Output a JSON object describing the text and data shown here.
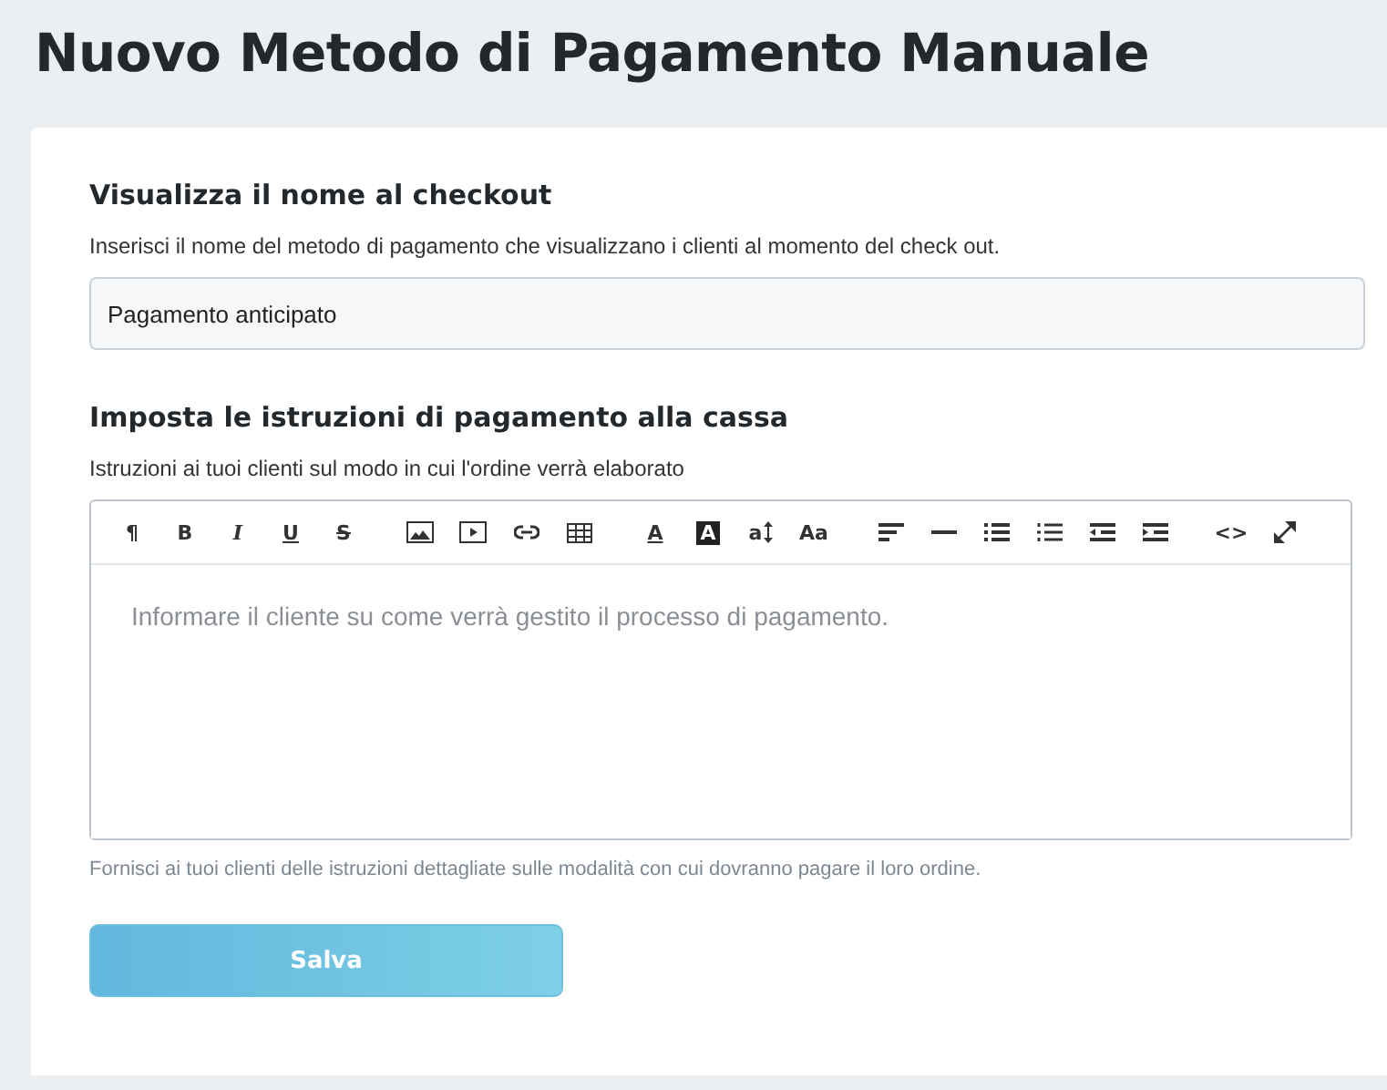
{
  "page_title": "Nuovo Metodo di Pagamento Manuale",
  "name_section": {
    "heading": "Visualizza il nome al checkout",
    "description": "Inserisci il nome del metodo di pagamento che visualizzano i clienti al momento del check out.",
    "value": "Pagamento anticipato"
  },
  "instructions_section": {
    "heading": "Imposta le istruzioni di pagamento alla cassa",
    "description": "Istruzioni ai tuoi clienti sul modo in cui l'ordine verrà elaborato",
    "placeholder": "Informare il cliente su come verrà gestito il processo di pagamento.",
    "hint": "Fornisci ai tuoi clienti delle istruzioni dettagliate sulle modalità con cui dovranno pagare il loro ordine."
  },
  "toolbar_groups": [
    [
      {
        "kind": "glyph",
        "label": "¶"
      },
      {
        "kind": "bold",
        "label": "B"
      },
      {
        "kind": "italic",
        "label": "I"
      },
      {
        "kind": "underline",
        "label": "U"
      },
      {
        "kind": "strike",
        "label": "S"
      }
    ],
    [
      {
        "kind": "image"
      },
      {
        "kind": "video"
      },
      {
        "kind": "link"
      },
      {
        "kind": "table"
      }
    ],
    [
      {
        "kind": "font-color",
        "label": "A"
      },
      {
        "kind": "bg-color",
        "label": "A"
      },
      {
        "kind": "font-size",
        "label": "a"
      },
      {
        "kind": "glyph",
        "label": "Aa"
      }
    ],
    [
      {
        "kind": "align"
      },
      {
        "kind": "hr"
      },
      {
        "kind": "ul"
      },
      {
        "kind": "ol"
      },
      {
        "kind": "outdent"
      },
      {
        "kind": "indent"
      }
    ],
    [
      {
        "kind": "glyph",
        "label": "<>"
      },
      {
        "kind": "fullscreen"
      }
    ]
  ],
  "save_button": {
    "label": "Salva",
    "disabled": true
  }
}
